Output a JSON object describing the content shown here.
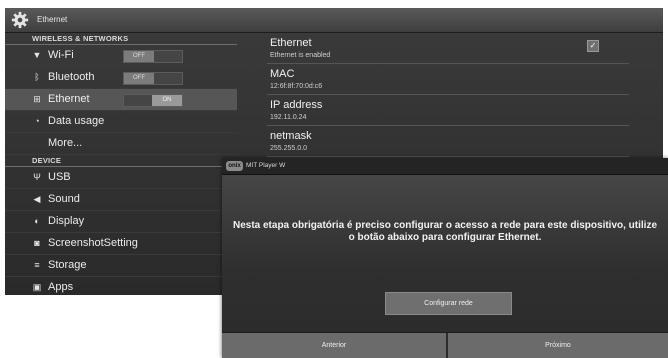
{
  "settings": {
    "title": "Ethernet",
    "sections": {
      "wireless": "WIRELESS & NETWORKS",
      "device": "DEVICE"
    },
    "items": [
      {
        "label": "Wi-Fi",
        "icon": "wifi-icon",
        "toggle": "OFF"
      },
      {
        "label": "Bluetooth",
        "icon": "bluetooth-icon",
        "toggle": "OFF"
      },
      {
        "label": "Ethernet",
        "icon": "ethernet-icon",
        "toggle": "ON",
        "selected": true
      },
      {
        "label": "Data usage",
        "icon": "data-usage-icon"
      },
      {
        "label": "More..."
      },
      {
        "label": "USB",
        "icon": "usb-icon"
      },
      {
        "label": "Sound",
        "icon": "sound-icon"
      },
      {
        "label": "Display",
        "icon": "display-icon"
      },
      {
        "label": "ScreenshotSetting",
        "icon": "camera-icon"
      },
      {
        "label": "Storage",
        "icon": "storage-icon"
      },
      {
        "label": "Apps",
        "icon": "apps-icon"
      }
    ],
    "details": [
      {
        "title": "Ethernet",
        "summary": "Ethernet is enabled",
        "checked": true
      },
      {
        "title": "MAC",
        "summary": "12:6f:8f:70:0d:c6"
      },
      {
        "title": "IP address",
        "summary": "192.11.0.24"
      },
      {
        "title": "netmask",
        "summary": "255.255.0.0"
      }
    ]
  },
  "dialog": {
    "logo": "onix",
    "title": "MIT Player W",
    "message": "Nesta etapa obrigatória é preciso configurar o acesso a rede para este dispositivo, utilize o botão abaixo para configurar Ethernet.",
    "config_button": "Configurar rede",
    "prev_button": "Anterior",
    "next_button": "Próximo"
  }
}
